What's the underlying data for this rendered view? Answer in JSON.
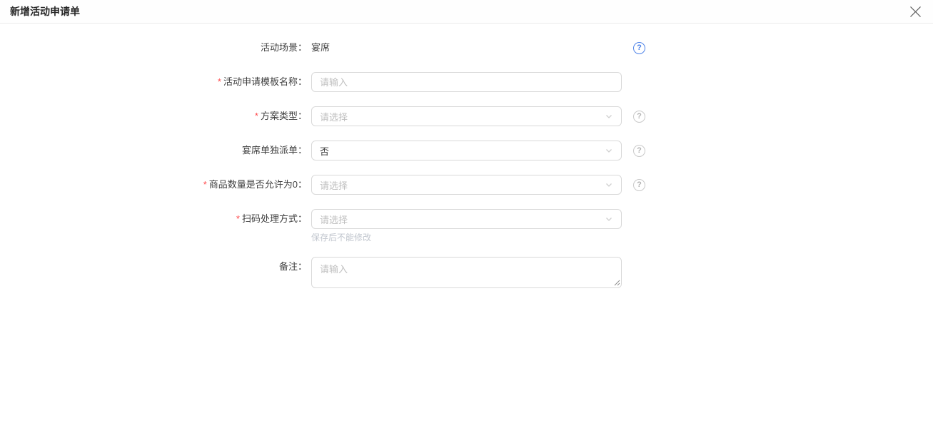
{
  "dialog": {
    "title": "新增活动申请单"
  },
  "icons": {
    "help_glyph": "?",
    "required_mark": "*",
    "close": "x-cross",
    "chevron": "chevron-down"
  },
  "colors": {
    "help_blue": "#4e83e8",
    "help_gray": "#c9c9c9",
    "required_red": "#ff4d4f",
    "field_border": "#d9d9d9",
    "placeholder_gray": "#bfbfbf"
  },
  "form": {
    "fields": [
      {
        "label": "活动场景：",
        "type": "static",
        "value": "宴席",
        "help": "blue"
      },
      {
        "label": "活动申请模板名称：",
        "required": true,
        "type": "input",
        "placeholder": "请输入"
      },
      {
        "label": "方案类型：",
        "required": true,
        "type": "select",
        "placeholder": "请选择",
        "help": "gray"
      },
      {
        "label": "宴席单独派单：",
        "type": "select",
        "value": "否",
        "help": "gray"
      },
      {
        "label": "商品数量是否允许为0：",
        "required": true,
        "type": "select",
        "placeholder": "请选择",
        "help": "gray"
      },
      {
        "label": "扫码处理方式：",
        "required": true,
        "type": "select",
        "placeholder": "请选择",
        "note": "保存后不能修改"
      },
      {
        "label": "备注：",
        "type": "textarea",
        "placeholder": "请输入"
      }
    ]
  }
}
